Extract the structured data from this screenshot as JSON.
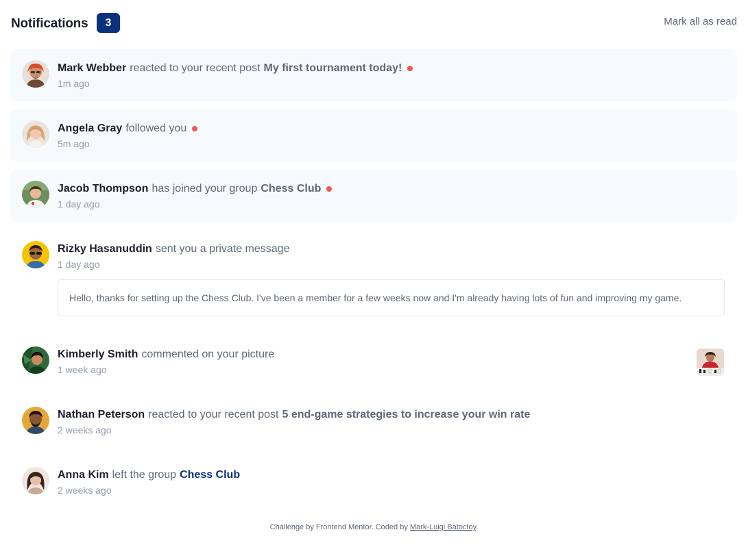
{
  "header": {
    "title": "Notifications",
    "unread_count": "3",
    "mark_all_label": "Mark all as read"
  },
  "notifications": [
    {
      "name": "Mark Webber",
      "action": "reacted to your recent post",
      "target": "My first tournament today!",
      "time": "1m ago",
      "unread": true,
      "avatar_icon": "avatar-mark-webber"
    },
    {
      "name": "Angela Gray",
      "action": "followed you",
      "target": "",
      "time": "5m ago",
      "unread": true,
      "avatar_icon": "avatar-angela-gray"
    },
    {
      "name": "Jacob Thompson",
      "action": "has joined your group",
      "target": "Chess Club",
      "time": "1 day ago",
      "unread": true,
      "avatar_icon": "avatar-jacob-thompson"
    },
    {
      "name": "Rizky Hasanuddin",
      "action": "sent you a private message",
      "target": "",
      "time": "1 day ago",
      "unread": false,
      "avatar_icon": "avatar-rizky-hasanuddin",
      "message": "Hello, thanks for setting up the Chess Club. I've been a member for a few weeks now and I'm already having lots of fun and improving my game."
    },
    {
      "name": "Kimberly Smith",
      "action": "commented on your picture",
      "target": "",
      "time": "1 week ago",
      "unread": false,
      "avatar_icon": "avatar-kimberly-smith",
      "picture_icon": "chess-picture-thumbnail"
    },
    {
      "name": "Nathan Peterson",
      "action": "reacted to your recent post",
      "target": "5 end-game strategies to increase your win rate",
      "time": "2 weeks ago",
      "unread": false,
      "avatar_icon": "avatar-nathan-peterson"
    },
    {
      "name": "Anna Kim",
      "action": "left the group",
      "target": "Chess Club",
      "time": "2 weeks ago",
      "unread": false,
      "avatar_icon": "avatar-anna-kim"
    }
  ],
  "footer": {
    "prefix": "Challenge by Frontend Mentor. Coded by",
    "author": "Mark-Luigi Batoctoy",
    "suffix": "."
  },
  "colors": {
    "unread_bg": "#f7fafd",
    "dot": "#f65552",
    "badge": "#0a327b",
    "group_link": "#0a327b"
  }
}
